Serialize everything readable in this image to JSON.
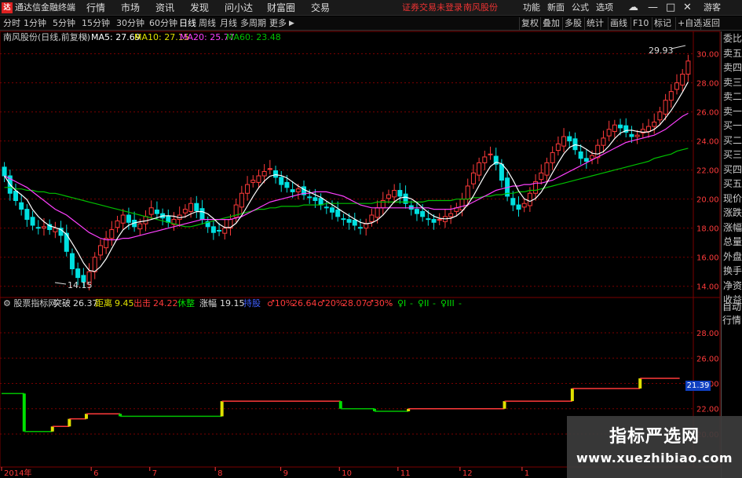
{
  "menubar": {
    "app_title": "通达信金融终端",
    "logo": "达",
    "items": [
      "行情",
      "市场",
      "资讯",
      "发现",
      "问小达",
      "财富圈",
      "交易"
    ],
    "notice": "证券交易未登录",
    "stock": "南风股份",
    "right": [
      "功能",
      "新面",
      "公式",
      "选项",
      "游客"
    ]
  },
  "toolbar": {
    "periods": [
      "分时",
      "1分钟",
      "5分钟",
      "15分钟",
      "30分钟",
      "60分钟",
      "日线",
      "周线",
      "月线",
      "多周期",
      "更多"
    ],
    "active": "日线",
    "buttons": [
      "复权",
      "叠加",
      "多股",
      "统计",
      "画线",
      "F10",
      "标记",
      "+自选",
      "返回"
    ]
  },
  "main_legend": {
    "title": "南风股份(日线,前复权)",
    "ma5": "MA5: 27.69",
    "ma10": "MA10: 27.15",
    "ma20": "MA20: 25.77",
    "ma60": "MA60: 23.48"
  },
  "annotations": {
    "high": "29.93",
    "low": "14.15"
  },
  "side_panel": [
    "委比",
    "卖五",
    "卖四",
    "卖三",
    "卖二",
    "卖一",
    "买一",
    "买二",
    "买三",
    "买四",
    "买五",
    "现价",
    "涨跌",
    "涨幅",
    "总量",
    "外盘",
    "换手",
    "净资",
    "收益"
  ],
  "indicator_legend": {
    "name": "股票指标网",
    "k1": "突破",
    "v1": "26.37",
    "k2": "距离",
    "v2": "9.45",
    "k3": "出击",
    "v3": "24.22",
    "k4": "休整",
    "k5": "涨幅",
    "v5": "19.15",
    "k6": "持股",
    "k7": "♂10%",
    "v7": "26.64",
    "k8": "♂20%",
    "v8": "28.07",
    "k9": "♂30%",
    "v9": "-",
    "k10": "♀I",
    "v10": "-",
    "k11": "♀II",
    "v11": "-",
    "k12": "♀III",
    "v12": "-"
  },
  "auto_panel": [
    "自动",
    "行情"
  ],
  "last_value_tag": "21.39",
  "time_labels": [
    "2014年",
    "6",
    "7",
    "8",
    "9",
    "10",
    "11",
    "12",
    "1"
  ],
  "watermark": {
    "line1": "指标严选网",
    "line2": "www.xuezhibiao.com"
  },
  "colors": {
    "up": "#ff3a3a",
    "down": "#00e0e0",
    "ma5": "#ffffff",
    "ma10": "#e0e000",
    "ma20": "#ff40ff",
    "ma60": "#00c000",
    "grid": "#7a0000"
  },
  "chart_data": {
    "type": "candlestick",
    "y_ticks": [
      30.0,
      28.0,
      26.0,
      24.0,
      22.0,
      20.0,
      18.0,
      16.0,
      14.0
    ],
    "ylim": [
      13.5,
      31.0
    ],
    "indicator_y_ticks": [
      28.0,
      26.0,
      24.0,
      22.0,
      20.0
    ],
    "indicator_ylim": [
      18.2,
      29.8
    ],
    "close_series": [
      21.6,
      20.4,
      19.9,
      19.3,
      18.6,
      18.2,
      18.0,
      18.1,
      17.9,
      18.0,
      17.5,
      16.4,
      15.2,
      14.6,
      14.3,
      15.0,
      16.0,
      16.8,
      17.3,
      17.9,
      18.5,
      18.9,
      18.4,
      18.1,
      18.3,
      18.8,
      19.4,
      19.0,
      18.7,
      18.4,
      18.6,
      18.9,
      19.3,
      19.7,
      19.2,
      18.6,
      18.1,
      17.7,
      17.8,
      18.0,
      18.6,
      19.6,
      20.4,
      21.0,
      21.3,
      21.6,
      21.9,
      22.1,
      21.5,
      21.0,
      20.8,
      20.5,
      20.7,
      20.3,
      20.1,
      19.9,
      19.6,
      19.4,
      19.1,
      18.8,
      18.6,
      18.4,
      18.2,
      18.0,
      18.3,
      18.9,
      19.4,
      19.9,
      20.3,
      20.6,
      20.2,
      19.7,
      19.3,
      19.0,
      18.8,
      18.6,
      18.4,
      18.6,
      18.8,
      19.0,
      19.4,
      20.0,
      20.9,
      21.8,
      22.5,
      22.9,
      23.1,
      22.4,
      21.3,
      20.2,
      19.6,
      19.3,
      19.7,
      20.4,
      21.2,
      21.8,
      22.5,
      23.2,
      23.8,
      24.3,
      24.0,
      23.4,
      22.8,
      22.6,
      23.0,
      23.7,
      24.2,
      24.8,
      25.1,
      24.9,
      24.6,
      24.3,
      24.4,
      24.8,
      25.0,
      25.3,
      26.0,
      26.8,
      27.4,
      28.0,
      28.6,
      29.5
    ],
    "ma5": [
      21.6,
      21.0,
      20.6,
      20.3,
      19.96,
      19.28,
      18.8,
      18.44,
      18.16,
      18.04,
      17.9,
      17.58,
      16.96,
      16.32,
      15.6,
      15.1,
      15.02,
      15.34,
      15.88,
      16.6,
      17.3,
      17.88,
      18.2,
      18.36,
      18.44,
      18.5,
      18.6,
      18.72,
      18.84,
      18.86,
      18.82,
      18.72,
      18.78,
      18.98,
      19.14,
      19.14,
      18.98,
      18.66,
      18.28,
      18.04,
      18.04,
      18.34,
      18.88,
      19.52,
      20.18,
      20.78,
      21.24,
      21.58,
      21.68,
      21.62,
      21.46,
      21.18,
      20.9,
      20.66,
      20.48,
      20.3,
      20.12,
      19.86,
      19.62,
      19.36,
      19.1,
      18.86,
      18.62,
      18.4,
      18.3,
      18.36,
      18.56,
      18.9,
      19.36,
      19.82,
      20.08,
      20.14,
      20.02,
      19.76,
      19.4,
      19.08,
      18.82,
      18.68,
      18.64,
      18.68,
      18.84,
      19.16,
      19.62,
      20.22,
      20.92,
      21.62,
      22.24,
      22.54,
      22.44,
      21.98,
      21.32,
      20.56,
      20.02,
      19.84,
      20.04,
      20.48,
      21.12,
      21.82,
      22.5,
      23.12,
      23.56,
      23.74,
      23.66,
      23.42,
      23.16,
      23.1,
      23.26,
      23.66,
      24.16,
      24.54,
      24.72,
      24.74,
      24.66,
      24.6,
      24.62,
      24.8,
      25.12,
      25.58,
      26.1,
      26.7,
      27.36,
      28.06
    ],
    "ma20": [
      21.6,
      21.4,
      21.2,
      21.0,
      20.8,
      20.5,
      20.2,
      19.9,
      19.6,
      19.3,
      19.1,
      18.9,
      18.6,
      18.3,
      18.0,
      17.7,
      17.5,
      17.3,
      17.2,
      17.2,
      17.2,
      17.3,
      17.3,
      17.4,
      17.5,
      17.6,
      17.7,
      17.8,
      17.9,
      18.0,
      18.1,
      18.2,
      18.3,
      18.4,
      18.5,
      18.6,
      18.6,
      18.6,
      18.6,
      18.6,
      18.6,
      18.7,
      18.8,
      19.0,
      19.2,
      19.4,
      19.6,
      19.8,
      19.9,
      20.0,
      20.1,
      20.2,
      20.3,
      20.4,
      20.4,
      20.5,
      20.5,
      20.5,
      20.4,
      20.3,
      20.2,
      20.0,
      19.8,
      19.6,
      19.5,
      19.4,
      19.4,
      19.4,
      19.4,
      19.4,
      19.4,
      19.4,
      19.4,
      19.4,
      19.4,
      19.4,
      19.3,
      19.3,
      19.3,
      19.3,
      19.4,
      19.5,
      19.6,
      19.8,
      20.0,
      20.2,
      20.4,
      20.6,
      20.7,
      20.8,
      20.9,
      20.9,
      21.0,
      21.0,
      21.1,
      21.1,
      21.2,
      21.3,
      21.5,
      21.7,
      21.9,
      22.1,
      22.3,
      22.5,
      22.7,
      22.9,
      23.1,
      23.3,
      23.5,
      23.7,
      23.9,
      24.0,
      24.1,
      24.2,
      24.3,
      24.4,
      24.6,
      24.8,
      25.1,
      25.4,
      25.7,
      25.9
    ],
    "ma60": [
      20.8,
      20.8,
      20.7,
      20.7,
      20.6,
      20.6,
      20.5,
      20.5,
      20.4,
      20.4,
      20.3,
      20.2,
      20.1,
      20.0,
      19.9,
      19.8,
      19.7,
      19.6,
      19.5,
      19.4,
      19.3,
      19.2,
      19.1,
      19.0,
      18.9,
      18.8,
      18.7,
      18.6,
      18.5,
      18.4,
      18.3,
      18.2,
      18.1,
      18.1,
      18.2,
      18.3,
      18.4,
      18.5,
      18.6,
      18.7,
      18.8,
      18.9,
      19.0,
      19.1,
      19.2,
      19.3,
      19.3,
      19.4,
      19.4,
      19.5,
      19.5,
      19.5,
      19.5,
      19.6,
      19.6,
      19.6,
      19.6,
      19.7,
      19.7,
      19.7,
      19.7,
      19.7,
      19.7,
      19.7,
      19.7,
      19.7,
      19.8,
      19.8,
      19.8,
      19.8,
      19.8,
      19.8,
      19.8,
      19.8,
      19.8,
      19.9,
      19.9,
      19.9,
      19.9,
      19.9,
      20.0,
      20.0,
      20.0,
      20.1,
      20.1,
      20.2,
      20.2,
      20.3,
      20.3,
      20.4,
      20.4,
      20.5,
      20.5,
      20.6,
      20.6,
      20.7,
      20.8,
      20.9,
      21.0,
      21.1,
      21.2,
      21.3,
      21.4,
      21.5,
      21.6,
      21.7,
      21.8,
      21.9,
      22.0,
      22.1,
      22.2,
      22.3,
      22.4,
      22.5,
      22.6,
      22.8,
      22.9,
      23.0,
      23.1,
      23.3,
      23.4,
      23.5
    ],
    "indicator_levels": [
      23.2,
      23.2,
      23.2,
      23.2,
      20.2,
      20.2,
      20.2,
      20.2,
      20.2,
      20.6,
      20.6,
      20.6,
      21.2,
      21.2,
      21.2,
      21.6,
      21.6,
      21.6,
      21.6,
      21.6,
      21.6,
      21.4,
      21.4,
      21.4,
      21.4,
      21.4,
      21.4,
      21.4,
      21.4,
      21.4,
      21.4,
      21.4,
      21.4,
      21.4,
      21.4,
      21.4,
      21.4,
      21.4,
      21.4,
      22.6,
      22.6,
      22.6,
      22.6,
      22.6,
      22.6,
      22.6,
      22.6,
      22.6,
      22.6,
      22.6,
      22.6,
      22.6,
      22.6,
      22.6,
      22.6,
      22.6,
      22.6,
      22.6,
      22.6,
      22.6,
      22.0,
      22.0,
      22.0,
      22.0,
      22.0,
      22.0,
      21.8,
      21.8,
      21.8,
      21.8,
      21.8,
      21.8,
      22.0,
      22.0,
      22.0,
      22.0,
      22.0,
      22.0,
      22.0,
      22.0,
      22.0,
      22.0,
      22.0,
      22.0,
      22.0,
      22.0,
      22.0,
      22.0,
      22.0,
      22.6,
      22.6,
      22.6,
      22.6,
      22.6,
      22.6,
      22.6,
      22.6,
      22.6,
      22.6,
      22.6,
      22.6,
      23.6,
      23.6,
      23.6,
      23.6,
      23.6,
      23.6,
      23.6,
      23.6,
      23.6,
      23.6,
      23.6,
      23.6,
      24.4,
      24.4,
      24.4,
      24.4,
      24.4,
      24.4,
      24.4
    ],
    "y_tick_labels": [
      "30.00",
      "28.00",
      "26.00",
      "24.00",
      "22.00",
      "20.00",
      "18.00",
      "16.00",
      "14.00"
    ],
    "indicator_tick_labels": [
      "28.00",
      "26.00",
      "24.00",
      "22.00",
      "20.00"
    ]
  }
}
